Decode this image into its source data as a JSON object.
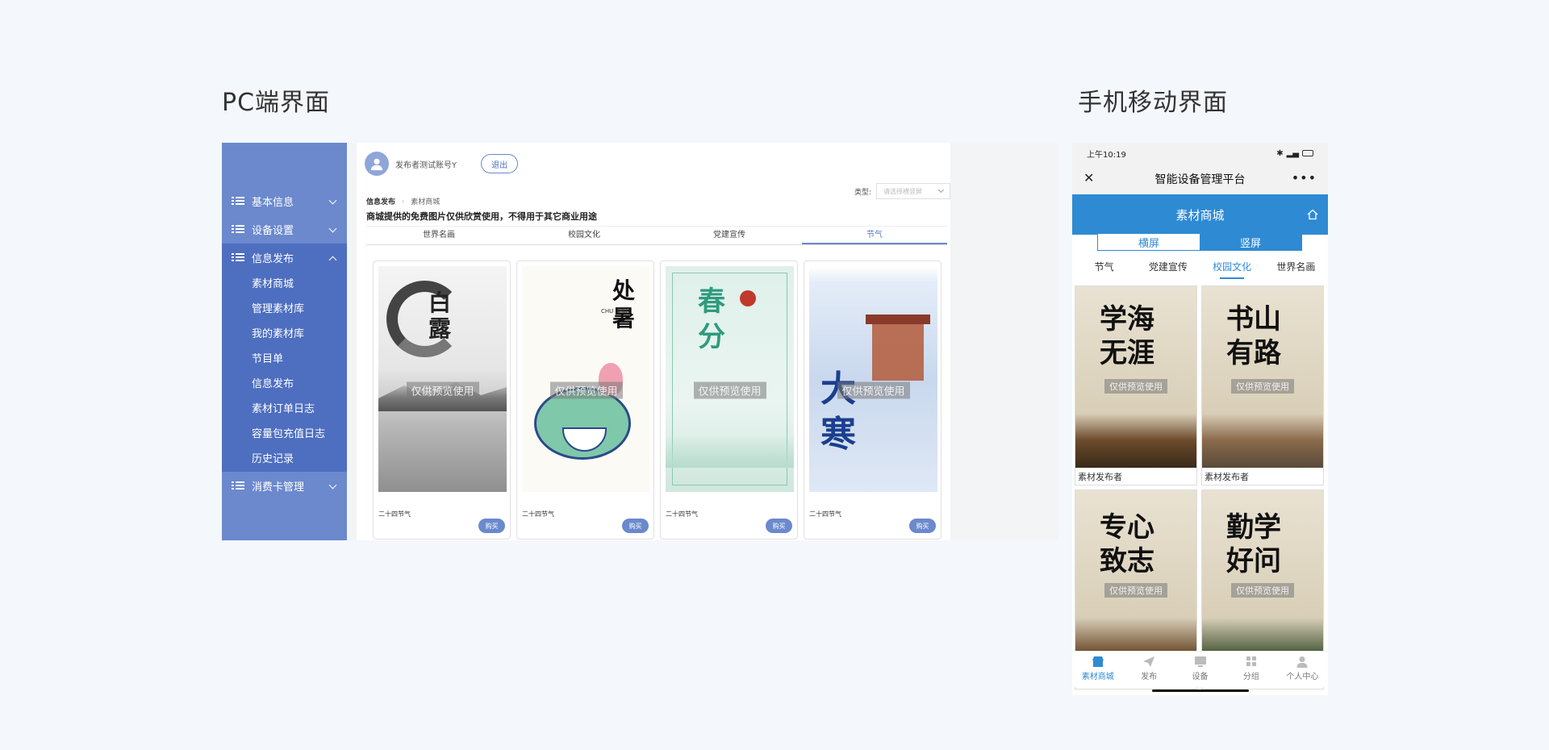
{
  "titles": {
    "pc": "PC端界面",
    "mobile": "手机移动界面"
  },
  "pc": {
    "sidebar": {
      "items": [
        {
          "label": "基本信息"
        },
        {
          "label": "设备设置"
        },
        {
          "label": "信息发布",
          "sub": [
            "素材商城",
            "管理素材库",
            "我的素材库",
            "节目单",
            "信息发布",
            "素材订单日志",
            "容量包充值日志",
            "历史记录"
          ]
        },
        {
          "label": "消费卡管理"
        }
      ]
    },
    "topbar": {
      "username": "发布者测试账号Y",
      "logout": "退出"
    },
    "type": {
      "label": "类型:",
      "placeholder": "请选择横竖屏"
    },
    "breadcrumb": [
      "信息发布",
      "素材商城"
    ],
    "notice": "商城提供的免费图片仅供欣赏使用，不得用于其它商业用途",
    "tabs": [
      "世界名画",
      "校园文化",
      "党建宣传",
      "节气"
    ],
    "active_tab": "节气",
    "cards": [
      {
        "label": "二十四节气",
        "buy": "购买",
        "chars": "白露",
        "watermark": "仅供预览使用"
      },
      {
        "label": "二十四节气",
        "buy": "购买",
        "chars": "处暑",
        "sub": "CHU SHU",
        "watermark": "仅供预览使用"
      },
      {
        "label": "二十四节气",
        "buy": "购买",
        "chars": "春分",
        "watermark": "仅供预览使用"
      },
      {
        "label": "二十四节气",
        "buy": "购买",
        "chars": "大寒",
        "watermark": "仅供预览使用"
      }
    ]
  },
  "mobile": {
    "status": {
      "time": "上午10:19"
    },
    "nav_title": "智能设备管理平台",
    "header": "素材商城",
    "orientation": [
      "横屏",
      "竖屏"
    ],
    "active_orientation": "竖屏",
    "tabs": [
      "节气",
      "党建宣传",
      "校园文化",
      "世界名画"
    ],
    "active_tab": "校园文化",
    "cards": [
      {
        "chars": "学海无涯",
        "label": "素材发布者",
        "watermark": "仅供预览使用"
      },
      {
        "chars": "书山有路",
        "label": "素材发布者",
        "watermark": "仅供预览使用"
      },
      {
        "chars": "专心致志",
        "label": "",
        "watermark": "仅供预览使用"
      },
      {
        "chars": "勤学好问",
        "label": "",
        "watermark": "仅供预览使用"
      }
    ],
    "bottom_nav": [
      "素材商城",
      "发布",
      "设备",
      "分组",
      "个人中心"
    ],
    "active_nav": "素材商城"
  },
  "colors": {
    "sidebar": "#6b89cc",
    "sidebar_active": "#4e6fc0",
    "mobile_accent": "#2f8ad4"
  }
}
